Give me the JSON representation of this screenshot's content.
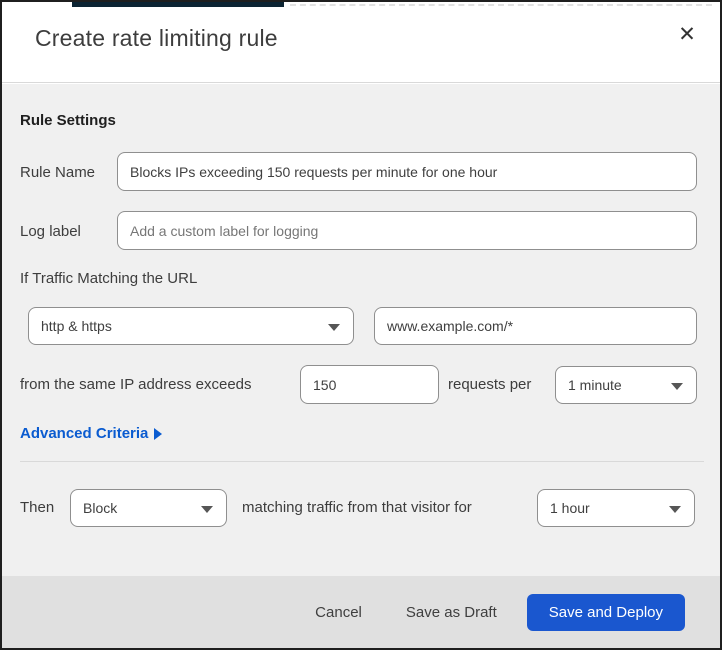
{
  "modal": {
    "title": "Create rate limiting rule",
    "close_icon": "✕",
    "section_heading": "Rule Settings",
    "rule_name": {
      "label": "Rule Name",
      "value": "Blocks IPs exceeding 150 requests per minute for one hour"
    },
    "log_label": {
      "label": "Log label",
      "placeholder": "Add a custom label for logging"
    },
    "match": {
      "intro": "If Traffic Matching the URL",
      "scheme_selected": "http & https",
      "url_value": "www.example.com/*",
      "threshold_prefix": "from the same IP address exceeds",
      "threshold_value": "150",
      "threshold_suffix": "requests per",
      "period_selected": "1 minute"
    },
    "advanced_criteria_label": "Advanced Criteria",
    "then": {
      "label": "Then",
      "action_selected": "Block",
      "middle_text": "matching traffic from that visitor for",
      "duration_selected": "1 hour"
    },
    "footer": {
      "cancel_label": "Cancel",
      "save_draft_label": "Save as Draft",
      "save_deploy_label": "Save and Deploy"
    },
    "colors": {
      "primary_button": "#1a57cf",
      "link_blue": "#0a5bd0",
      "top_bar_navy": "#0c2433"
    }
  }
}
